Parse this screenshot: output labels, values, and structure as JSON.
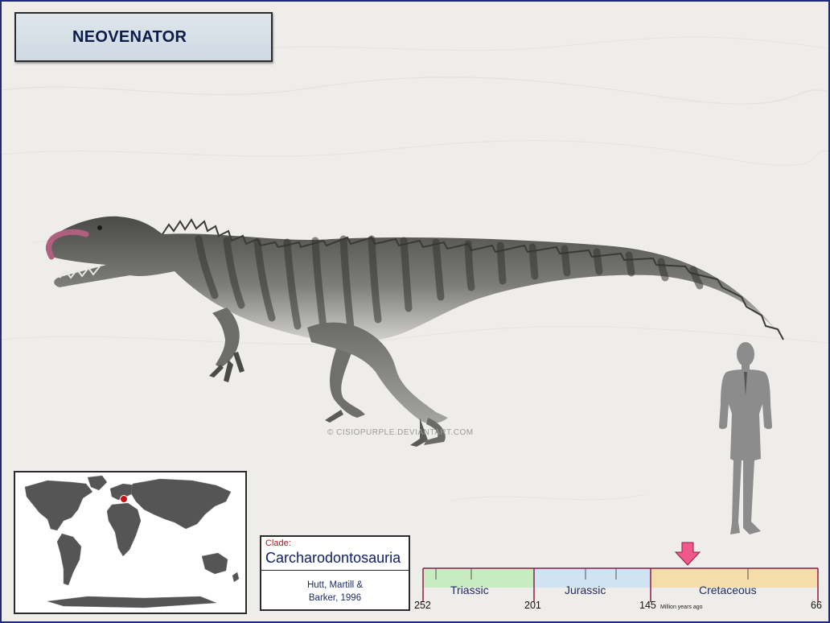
{
  "title": "NEOVENATOR",
  "watermark": "© CISIOPURPLE.DEVIANTART.COM",
  "clade": {
    "label": "Clade:",
    "name": "Carcharodontosauria",
    "authority_line1": "Hutt, Martill &",
    "authority_line2": "Barker, 1996"
  },
  "timeline": {
    "periods": [
      {
        "name": "Triassic",
        "color": "#c8ebc2"
      },
      {
        "name": "Jurassic",
        "color": "#cfe3f2"
      },
      {
        "name": "Cretaceous",
        "color": "#f6dcaa"
      }
    ],
    "boundaries": [
      "252",
      "201",
      "145",
      "66"
    ],
    "unit": "Million years ago",
    "marker_color": "#f0588a"
  },
  "colors": {
    "border": "#1f2a7a",
    "frame_line": "#8e1b4a",
    "land": "#555555",
    "locality": "#cc1111",
    "human": "#8c8c8c"
  },
  "icons": {
    "locality": "red-dot-icon",
    "marker": "down-arrow-icon",
    "scale": "human-silhouette-icon"
  }
}
